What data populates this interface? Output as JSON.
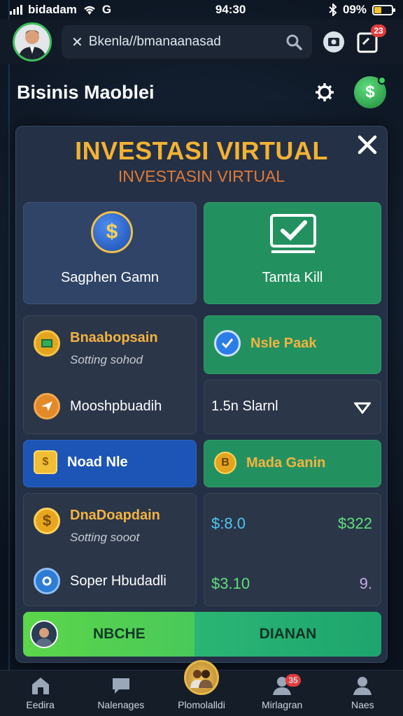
{
  "status_bar": {
    "carrier": "bidadam",
    "network_letter": "G",
    "time": "94:30",
    "battery_text": "09%"
  },
  "header": {
    "search_text": "Bkenla//bmanaanasad",
    "notification_count": "23"
  },
  "page": {
    "title": "Bisinis Maoblei"
  },
  "modal": {
    "title": "INVESTASI VIRTUAL",
    "subtitle": "INVESTASIN VIRTUAL",
    "tiles": {
      "saphen": "Sagphen Gamn",
      "tamta": "Tamta Kill"
    },
    "rows": {
      "bnaabopsain": {
        "title": "Bnaabopsain",
        "sub": "Sotting sohod"
      },
      "nsle": "Nsle Paak",
      "moosh": "Mooshpbuadih",
      "slarni": "1.5n Slarnl",
      "noad": "Noad Nle",
      "mada": "Mada Ganin",
      "dnadoapdain": {
        "title": "DnaDoapdain",
        "sub": "Sotting sooot"
      },
      "soper": "Soper Hbudadli",
      "val_1": "$:8.0",
      "val_2": "$322",
      "val_3": "$3.10",
      "val_4": "9."
    },
    "cta": {
      "left_label": "NBCHE",
      "right_label": "DIANAN"
    }
  },
  "nav": {
    "items": [
      {
        "label": "Eedira"
      },
      {
        "label": "Nalenages"
      },
      {
        "label": "Plomolalldi"
      },
      {
        "label": "Mirlagran",
        "badge": "35"
      },
      {
        "label": "Naes"
      }
    ]
  },
  "colors": {
    "accent_gold": "#f2b233",
    "green": "#23915f",
    "blue": "#1d55b6"
  }
}
